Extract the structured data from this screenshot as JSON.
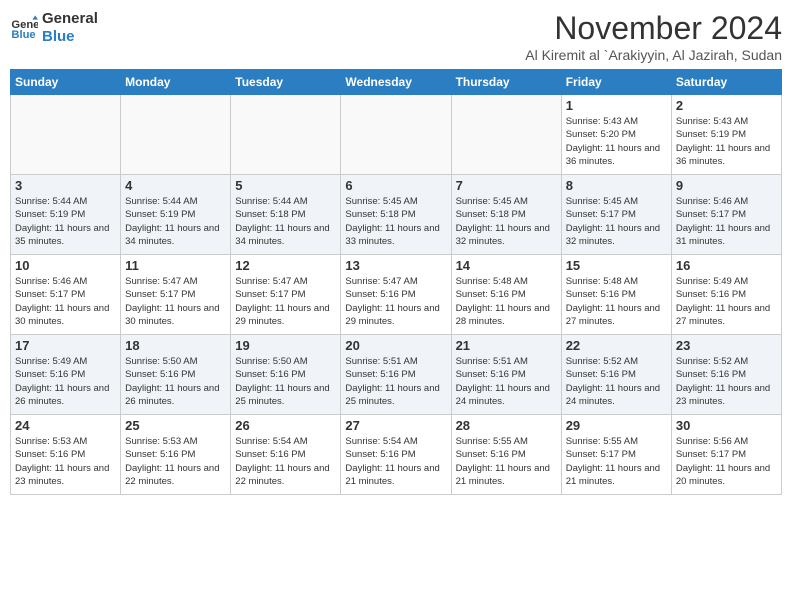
{
  "logo": {
    "line1": "General",
    "line2": "Blue"
  },
  "title": "November 2024",
  "subtitle": "Al Kiremit al `Arakiyyin, Al Jazirah, Sudan",
  "weekdays": [
    "Sunday",
    "Monday",
    "Tuesday",
    "Wednesday",
    "Thursday",
    "Friday",
    "Saturday"
  ],
  "weeks": [
    [
      {
        "day": "",
        "info": ""
      },
      {
        "day": "",
        "info": ""
      },
      {
        "day": "",
        "info": ""
      },
      {
        "day": "",
        "info": ""
      },
      {
        "day": "",
        "info": ""
      },
      {
        "day": "1",
        "info": "Sunrise: 5:43 AM\nSunset: 5:20 PM\nDaylight: 11 hours and 36 minutes."
      },
      {
        "day": "2",
        "info": "Sunrise: 5:43 AM\nSunset: 5:19 PM\nDaylight: 11 hours and 36 minutes."
      }
    ],
    [
      {
        "day": "3",
        "info": "Sunrise: 5:44 AM\nSunset: 5:19 PM\nDaylight: 11 hours and 35 minutes."
      },
      {
        "day": "4",
        "info": "Sunrise: 5:44 AM\nSunset: 5:19 PM\nDaylight: 11 hours and 34 minutes."
      },
      {
        "day": "5",
        "info": "Sunrise: 5:44 AM\nSunset: 5:18 PM\nDaylight: 11 hours and 34 minutes."
      },
      {
        "day": "6",
        "info": "Sunrise: 5:45 AM\nSunset: 5:18 PM\nDaylight: 11 hours and 33 minutes."
      },
      {
        "day": "7",
        "info": "Sunrise: 5:45 AM\nSunset: 5:18 PM\nDaylight: 11 hours and 32 minutes."
      },
      {
        "day": "8",
        "info": "Sunrise: 5:45 AM\nSunset: 5:17 PM\nDaylight: 11 hours and 32 minutes."
      },
      {
        "day": "9",
        "info": "Sunrise: 5:46 AM\nSunset: 5:17 PM\nDaylight: 11 hours and 31 minutes."
      }
    ],
    [
      {
        "day": "10",
        "info": "Sunrise: 5:46 AM\nSunset: 5:17 PM\nDaylight: 11 hours and 30 minutes."
      },
      {
        "day": "11",
        "info": "Sunrise: 5:47 AM\nSunset: 5:17 PM\nDaylight: 11 hours and 30 minutes."
      },
      {
        "day": "12",
        "info": "Sunrise: 5:47 AM\nSunset: 5:17 PM\nDaylight: 11 hours and 29 minutes."
      },
      {
        "day": "13",
        "info": "Sunrise: 5:47 AM\nSunset: 5:16 PM\nDaylight: 11 hours and 29 minutes."
      },
      {
        "day": "14",
        "info": "Sunrise: 5:48 AM\nSunset: 5:16 PM\nDaylight: 11 hours and 28 minutes."
      },
      {
        "day": "15",
        "info": "Sunrise: 5:48 AM\nSunset: 5:16 PM\nDaylight: 11 hours and 27 minutes."
      },
      {
        "day": "16",
        "info": "Sunrise: 5:49 AM\nSunset: 5:16 PM\nDaylight: 11 hours and 27 minutes."
      }
    ],
    [
      {
        "day": "17",
        "info": "Sunrise: 5:49 AM\nSunset: 5:16 PM\nDaylight: 11 hours and 26 minutes."
      },
      {
        "day": "18",
        "info": "Sunrise: 5:50 AM\nSunset: 5:16 PM\nDaylight: 11 hours and 26 minutes."
      },
      {
        "day": "19",
        "info": "Sunrise: 5:50 AM\nSunset: 5:16 PM\nDaylight: 11 hours and 25 minutes."
      },
      {
        "day": "20",
        "info": "Sunrise: 5:51 AM\nSunset: 5:16 PM\nDaylight: 11 hours and 25 minutes."
      },
      {
        "day": "21",
        "info": "Sunrise: 5:51 AM\nSunset: 5:16 PM\nDaylight: 11 hours and 24 minutes."
      },
      {
        "day": "22",
        "info": "Sunrise: 5:52 AM\nSunset: 5:16 PM\nDaylight: 11 hours and 24 minutes."
      },
      {
        "day": "23",
        "info": "Sunrise: 5:52 AM\nSunset: 5:16 PM\nDaylight: 11 hours and 23 minutes."
      }
    ],
    [
      {
        "day": "24",
        "info": "Sunrise: 5:53 AM\nSunset: 5:16 PM\nDaylight: 11 hours and 23 minutes."
      },
      {
        "day": "25",
        "info": "Sunrise: 5:53 AM\nSunset: 5:16 PM\nDaylight: 11 hours and 22 minutes."
      },
      {
        "day": "26",
        "info": "Sunrise: 5:54 AM\nSunset: 5:16 PM\nDaylight: 11 hours and 22 minutes."
      },
      {
        "day": "27",
        "info": "Sunrise: 5:54 AM\nSunset: 5:16 PM\nDaylight: 11 hours and 21 minutes."
      },
      {
        "day": "28",
        "info": "Sunrise: 5:55 AM\nSunset: 5:16 PM\nDaylight: 11 hours and 21 minutes."
      },
      {
        "day": "29",
        "info": "Sunrise: 5:55 AM\nSunset: 5:17 PM\nDaylight: 11 hours and 21 minutes."
      },
      {
        "day": "30",
        "info": "Sunrise: 5:56 AM\nSunset: 5:17 PM\nDaylight: 11 hours and 20 minutes."
      }
    ]
  ],
  "colors": {
    "header_bg": "#2b7ec1",
    "row_shaded": "#f0f4f8",
    "row_normal": "#ffffff"
  }
}
